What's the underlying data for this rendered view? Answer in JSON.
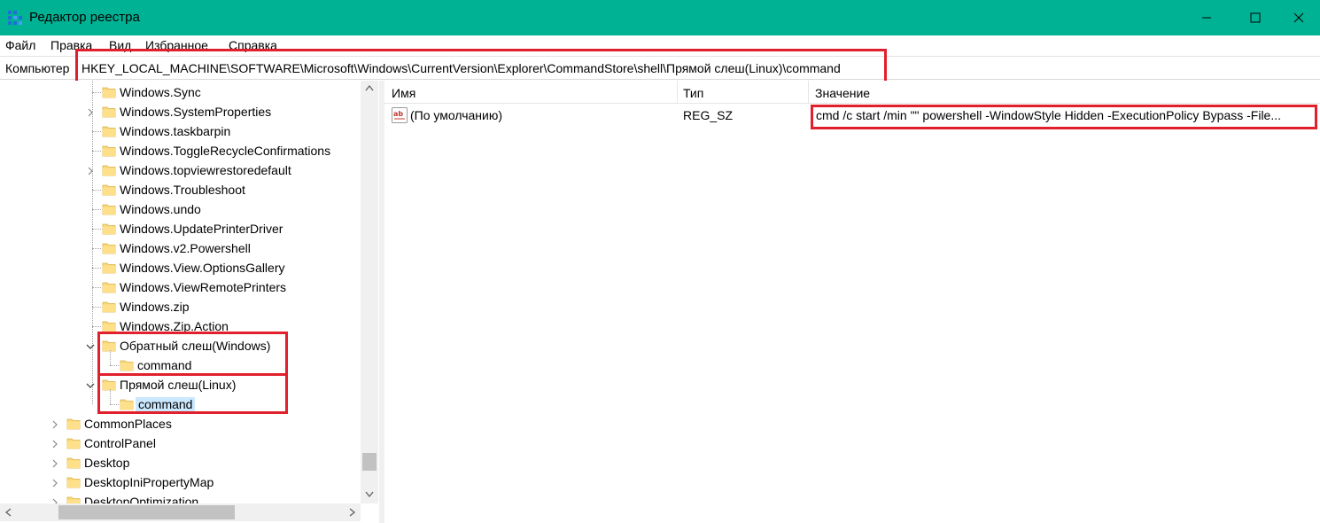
{
  "window": {
    "title": "Редактор реестра",
    "accent_color": "#00b294",
    "controls": {
      "minimize": "minimize-icon",
      "maximize": "maximize-icon",
      "close": "close-icon"
    }
  },
  "menu": [
    "Файл",
    "Правка",
    "Вид",
    "Избранное",
    "Справка"
  ],
  "address": {
    "label": "Компьютер",
    "path": "HKEY_LOCAL_MACHINE\\SOFTWARE\\Microsoft\\Windows\\CurrentVersion\\Explorer\\CommandStore\\shell\\Прямой слеш(Linux)\\command"
  },
  "tree": [
    {
      "label": "Windows.Sync",
      "expandable": false
    },
    {
      "label": "Windows.SystemProperties",
      "expandable": true
    },
    {
      "label": "Windows.taskbarpin",
      "expandable": false
    },
    {
      "label": "Windows.ToggleRecycleConfirmations",
      "expandable": false
    },
    {
      "label": "Windows.topviewrestoredefault",
      "expandable": true
    },
    {
      "label": "Windows.Troubleshoot",
      "expandable": false
    },
    {
      "label": "Windows.undo",
      "expandable": false
    },
    {
      "label": "Windows.UpdatePrinterDriver",
      "expandable": false
    },
    {
      "label": "Windows.v2.Powershell",
      "expandable": false
    },
    {
      "label": "Windows.View.OptionsGallery",
      "expandable": false
    },
    {
      "label": "Windows.ViewRemotePrinters",
      "expandable": false
    },
    {
      "label": "Windows.zip",
      "expandable": false
    },
    {
      "label": "Windows.Zip.Action",
      "expandable": false
    },
    {
      "label": "Обратный слеш(Windows)",
      "expandable": true,
      "expanded": true
    },
    {
      "label": "command",
      "expandable": false
    },
    {
      "label": "Прямой слеш(Linux)",
      "expandable": true,
      "expanded": true
    },
    {
      "label": "command",
      "expandable": false,
      "selected": true
    },
    {
      "label": "CommonPlaces",
      "expandable": true
    },
    {
      "label": "ControlPanel",
      "expandable": true
    },
    {
      "label": "Desktop",
      "expandable": true
    },
    {
      "label": "DesktopIniPropertyMap",
      "expandable": true
    },
    {
      "label": "DesktopOptimization",
      "expandable": true
    }
  ],
  "list": {
    "columns": [
      "Имя",
      "Тип",
      "Значение"
    ],
    "rows": [
      {
        "icon": "string-value-icon",
        "name": "(По умолчанию)",
        "type": "REG_SZ",
        "value": "cmd /c start /min \"\" powershell -WindowStyle Hidden -ExecutionPolicy Bypass -File..."
      }
    ]
  },
  "highlight_color": "#e0202c",
  "selection_color": "#cce8ff"
}
